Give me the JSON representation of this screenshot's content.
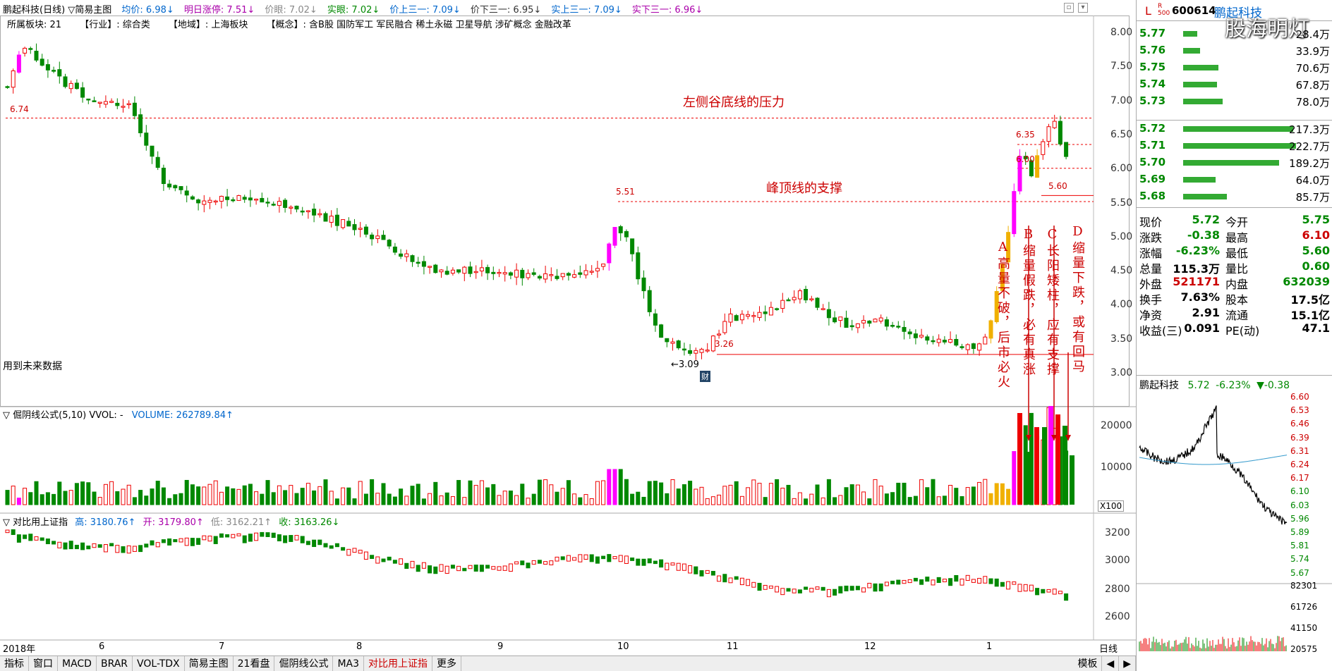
{
  "info": {
    "title": "鹏起科技(日线) ▽简易主图",
    "avg": "均价: 6.98↓",
    "next_limit": "明日涨停: 7.51↓",
    "price_eye": "价眼: 7.02↓",
    "solid_eye": "实眼: 7.02↓",
    "price_up3": "价上三一: 7.09↓",
    "price_down3": "价下三一: 6.95↓",
    "solid_up3": "实上三一: 7.09↓",
    "solid_down3": "实下三一: 6.96↓"
  },
  "concept": {
    "board": "所属板块: 21",
    "industry": "【行业】: 综合类",
    "region": "【地域】: 上海板块",
    "concepts": "【概念】: 含B股 国防军工 军民融合 稀土永磁 卫星导航 涉矿概念 金融改革"
  },
  "price_axis": [
    "8.00",
    "7.50",
    "7.00",
    "6.50",
    "6.00",
    "5.50",
    "5.00",
    "4.50",
    "4.00",
    "3.50",
    "3.00"
  ],
  "labels": {
    "p674": "6.74",
    "p635": "6.35",
    "p600": "6.00",
    "p551": "5.51",
    "p560": "5.60",
    "p326": "3.26",
    "p309": "←3.09",
    "future": "用到未来数据",
    "cai": "财",
    "watermark": "股海明灯"
  },
  "annotations": {
    "left_pressure": "左侧谷底线的压力",
    "peak_support": "峰顶线的支撑",
    "a": "A高量不破，后市必火",
    "b": "B缩量假跌，必有真涨",
    "c": "C长阳矮柱，应有支撑",
    "d": "D缩量下跌，或有回马"
  },
  "vol": {
    "title": "▽ 倔阴线公式(5,10) VVOL: -",
    "volume": "VOLUME: 262789.84↑",
    "axis": [
      "20000",
      "10000"
    ],
    "unit": "X100"
  },
  "index": {
    "title": "▽ 对比用上证指",
    "high": "高: 3180.76↑",
    "open": "开: 3179.80↑",
    "low": "低: 3162.21↑",
    "close": "收: 3163.26↓",
    "axis": [
      "3200",
      "3000",
      "2800",
      "2600"
    ]
  },
  "xaxis": [
    "2018年",
    "6",
    "7",
    "8",
    "9",
    "10",
    "11",
    "12",
    "1"
  ],
  "tabs": [
    "指标",
    "窗口",
    "MACD",
    "BRAR",
    "VOL-TDX",
    "简易主图",
    "21看盘",
    "倔阴线公式",
    "MA3",
    "对比用上证指",
    "更多"
  ],
  "right_tabs": [
    "模板",
    "日线"
  ],
  "stock": {
    "code": "600614",
    "name": "鹏起科技",
    "badge": "R 500",
    "mark": "L"
  },
  "orders_sell": [
    {
      "p": "5.77",
      "v": "28.4万",
      "w": 20
    },
    {
      "p": "5.76",
      "v": "33.9万",
      "w": 24
    },
    {
      "p": "5.75",
      "v": "70.6万",
      "w": 50
    },
    {
      "p": "5.74",
      "v": "67.8万",
      "w": 48
    },
    {
      "p": "5.73",
      "v": "78.0万",
      "w": 56
    }
  ],
  "orders_buy": [
    {
      "p": "5.72",
      "v": "217.3万",
      "w": 156
    },
    {
      "p": "5.71",
      "v": "222.7万",
      "w": 160
    },
    {
      "p": "5.70",
      "v": "189.2万",
      "w": 136
    },
    {
      "p": "5.69",
      "v": "64.0万",
      "w": 46
    },
    {
      "p": "5.68",
      "v": "85.7万",
      "w": 62
    }
  ],
  "quote": [
    {
      "k1": "现价",
      "v1": "5.72",
      "k2": "今开",
      "v2": "5.75",
      "c1": "#080",
      "c2": "#080"
    },
    {
      "k1": "涨跌",
      "v1": "-0.38",
      "k2": "最高",
      "v2": "6.10",
      "c1": "#080",
      "c2": "#c00"
    },
    {
      "k1": "涨幅",
      "v1": "-6.23%",
      "k2": "最低",
      "v2": "5.60",
      "c1": "#080",
      "c2": "#080"
    },
    {
      "k1": "总量",
      "v1": "115.3万",
      "k2": "量比",
      "v2": "0.60",
      "c1": "#000",
      "c2": "#080"
    },
    {
      "k1": "外盘",
      "v1": "521171",
      "k2": "内盘",
      "v2": "632039",
      "c1": "#c00",
      "c2": "#080"
    },
    {
      "k1": "换手",
      "v1": "7.63%",
      "k2": "股本",
      "v2": "17.5亿",
      "c1": "#000",
      "c2": "#000"
    },
    {
      "k1": "净资",
      "v1": "2.91",
      "k2": "流通",
      "v2": "15.1亿",
      "c1": "#000",
      "c2": "#000"
    },
    {
      "k1": "收益(三)",
      "v1": "0.091",
      "k2": "PE(动)",
      "v2": "47.1",
      "c1": "#000",
      "c2": "#000"
    }
  ],
  "mini": {
    "title": "鹏起科技",
    "price": "5.72",
    "chg": "-6.23%",
    "diff": "▼-0.38",
    "axis": [
      "6.60",
      "6.53",
      "6.46",
      "6.39",
      "6.31",
      "6.24",
      "6.17",
      "6.10",
      "6.03",
      "5.96",
      "5.89",
      "5.81",
      "5.74",
      "5.67"
    ],
    "vol_axis": [
      "82301",
      "61726",
      "41150",
      "20575"
    ]
  },
  "colors": {
    "up": "#e00",
    "down": "#080",
    "magenta": "#f0f",
    "gold": "#f0b000"
  }
}
